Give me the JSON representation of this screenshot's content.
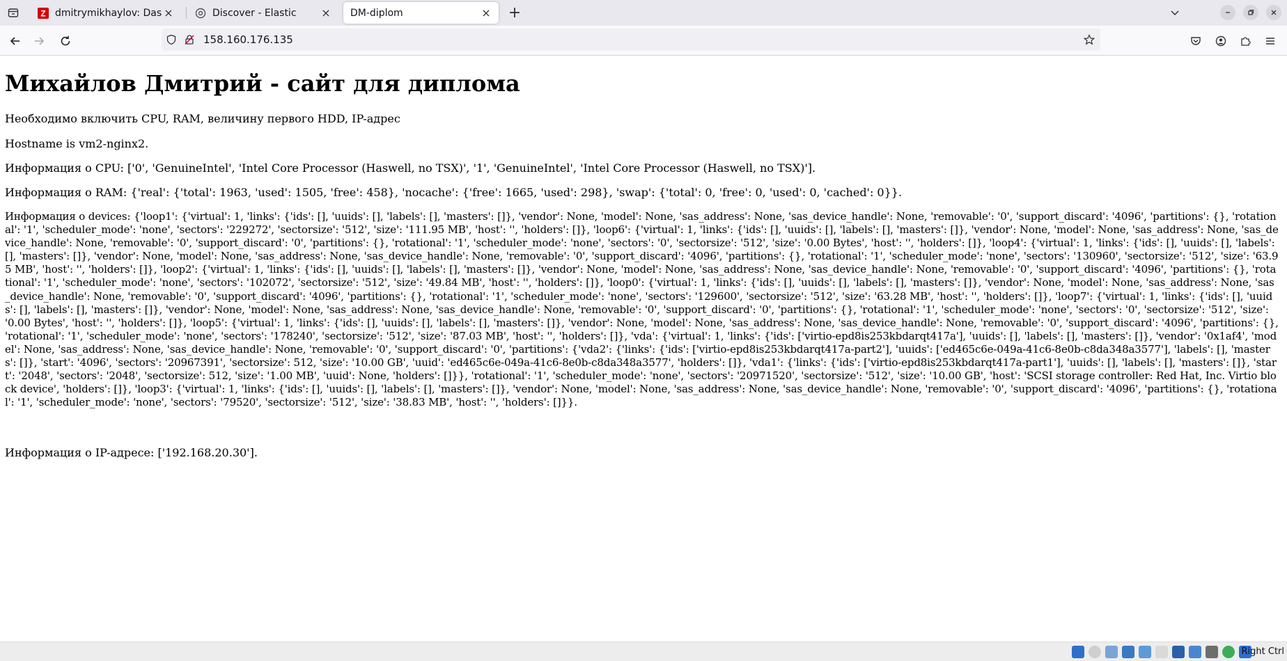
{
  "browser": {
    "tabs": [
      {
        "title": "dmitrymikhaylov: Dashbo",
        "favicon": "zabbix-z-icon",
        "favicon_color": "#d40000",
        "active": false
      },
      {
        "title": "Discover - Elastic",
        "favicon": "elastic-icon",
        "active": false
      },
      {
        "title": "DM-diplom",
        "favicon": "",
        "active": true
      }
    ],
    "url": "158.160.176.135",
    "new_tab_symbol": "+",
    "close_symbol": "×"
  },
  "page": {
    "heading": "Михайлов Дмитрий - сайт для диплома",
    "intro": "Необходимо включить CPU, RAM, величину первого HDD, IP-адрес",
    "hostname": "Hostname is vm2-nginx2.",
    "cpu": "Информация о CPU: ['0', 'GenuineIntel', 'Intel Core Processor (Haswell, no TSX)', '1', 'GenuineIntel', 'Intel Core Processor (Haswell, no TSX)'].",
    "ram": "Информация о RAM: {'real': {'total': 1963, 'used': 1505, 'free': 458}, 'nocache': {'free': 1665, 'used': 298}, 'swap': {'total': 0, 'free': 0, 'used': 0, 'cached': 0}}.",
    "devices": "Информация о devices: {'loop1': {'virtual': 1, 'links': {'ids': [], 'uuids': [], 'labels': [], 'masters': []}, 'vendor': None, 'model': None, 'sas_address': None, 'sas_device_handle': None, 'removable': '0', 'support_discard': '4096', 'partitions': {}, 'rotational': '1', 'scheduler_mode': 'none', 'sectors': '229272', 'sectorsize': '512', 'size': '111.95 MB', 'host': '', 'holders': []}, 'loop6': {'virtual': 1, 'links': {'ids': [], 'uuids': [], 'labels': [], 'masters': []}, 'vendor': None, 'model': None, 'sas_address': None, 'sas_device_handle': None, 'removable': '0', 'support_discard': '0', 'partitions': {}, 'rotational': '1', 'scheduler_mode': 'none', 'sectors': '0', 'sectorsize': '512', 'size': '0.00 Bytes', 'host': '', 'holders': []}, 'loop4': {'virtual': 1, 'links': {'ids': [], 'uuids': [], 'labels': [], 'masters': []}, 'vendor': None, 'model': None, 'sas_address': None, 'sas_device_handle': None, 'removable': '0', 'support_discard': '4096', 'partitions': {}, 'rotational': '1', 'scheduler_mode': 'none', 'sectors': '130960', 'sectorsize': '512', 'size': '63.95 MB', 'host': '', 'holders': []}, 'loop2': {'virtual': 1, 'links': {'ids': [], 'uuids': [], 'labels': [], 'masters': []}, 'vendor': None, 'model': None, 'sas_address': None, 'sas_device_handle': None, 'removable': '0', 'support_discard': '4096', 'partitions': {}, 'rotational': '1', 'scheduler_mode': 'none', 'sectors': '102072', 'sectorsize': '512', 'size': '49.84 MB', 'host': '', 'holders': []}, 'loop0': {'virtual': 1, 'links': {'ids': [], 'uuids': [], 'labels': [], 'masters': []}, 'vendor': None, 'model': None, 'sas_address': None, 'sas_device_handle': None, 'removable': '0', 'support_discard': '4096', 'partitions': {}, 'rotational': '1', 'scheduler_mode': 'none', 'sectors': '129600', 'sectorsize': '512', 'size': '63.28 MB', 'host': '', 'holders': []}, 'loop7': {'virtual': 1, 'links': {'ids': [], 'uuids': [], 'labels': [], 'masters': []}, 'vendor': None, 'model': None, 'sas_address': None, 'sas_device_handle': None, 'removable': '0', 'support_discard': '0', 'partitions': {}, 'rotational': '1', 'scheduler_mode': 'none', 'sectors': '0', 'sectorsize': '512', 'size': '0.00 Bytes', 'host': '', 'holders': []}, 'loop5': {'virtual': 1, 'links': {'ids': [], 'uuids': [], 'labels': [], 'masters': []}, 'vendor': None, 'model': None, 'sas_address': None, 'sas_device_handle': None, 'removable': '0', 'support_discard': '4096', 'partitions': {}, 'rotational': '1', 'scheduler_mode': 'none', 'sectors': '178240', 'sectorsize': '512', 'size': '87.03 MB', 'host': '', 'holders': []}, 'vda': {'virtual': 1, 'links': {'ids': ['virtio-epd8is253kbdarqt417a'], 'uuids': [], 'labels': [], 'masters': []}, 'vendor': '0x1af4', 'model': None, 'sas_address': None, 'sas_device_handle': None, 'removable': '0', 'support_discard': '0', 'partitions': {'vda2': {'links': {'ids': ['virtio-epd8is253kbdarqt417a-part2'], 'uuids': ['ed465c6e-049a-41c6-8e0b-c8da348a3577'], 'labels': [], 'masters': []}, 'start': '4096', 'sectors': '20967391', 'sectorsize': 512, 'size': '10.00 GB', 'uuid': 'ed465c6e-049a-41c6-8e0b-c8da348a3577', 'holders': []}, 'vda1': {'links': {'ids': ['virtio-epd8is253kbdarqt417a-part1'], 'uuids': [], 'labels': [], 'masters': []}, 'start': '2048', 'sectors': '2048', 'sectorsize': 512, 'size': '1.00 MB', 'uuid': None, 'holders': []}}, 'rotational': '1', 'scheduler_mode': 'none', 'sectors': '20971520', 'sectorsize': '512', 'size': '10.00 GB', 'host': 'SCSI storage controller: Red Hat, Inc. Virtio block device', 'holders': []}, 'loop3': {'virtual': 1, 'links': {'ids': [], 'uuids': [], 'labels': [], 'masters': []}, 'vendor': None, 'model': None, 'sas_address': None, 'sas_device_handle': None, 'removable': '0', 'support_discard': '4096', 'partitions': {}, 'rotational': '1', 'scheduler_mode': 'none', 'sectors': '79520', 'sectorsize': '512', 'size': '38.83 MB', 'host': '', 'holders': []}}.",
    "ip": "Информация о IP-адресе: ['192.168.20.30']."
  },
  "statusbar": {
    "host_key_label": "Right Ctrl"
  },
  "colors": {
    "tabbar_bg": "#e9e8ee",
    "toolbar_bg": "#f9f9fb",
    "urlbar_bg": "#f0f0f4"
  }
}
